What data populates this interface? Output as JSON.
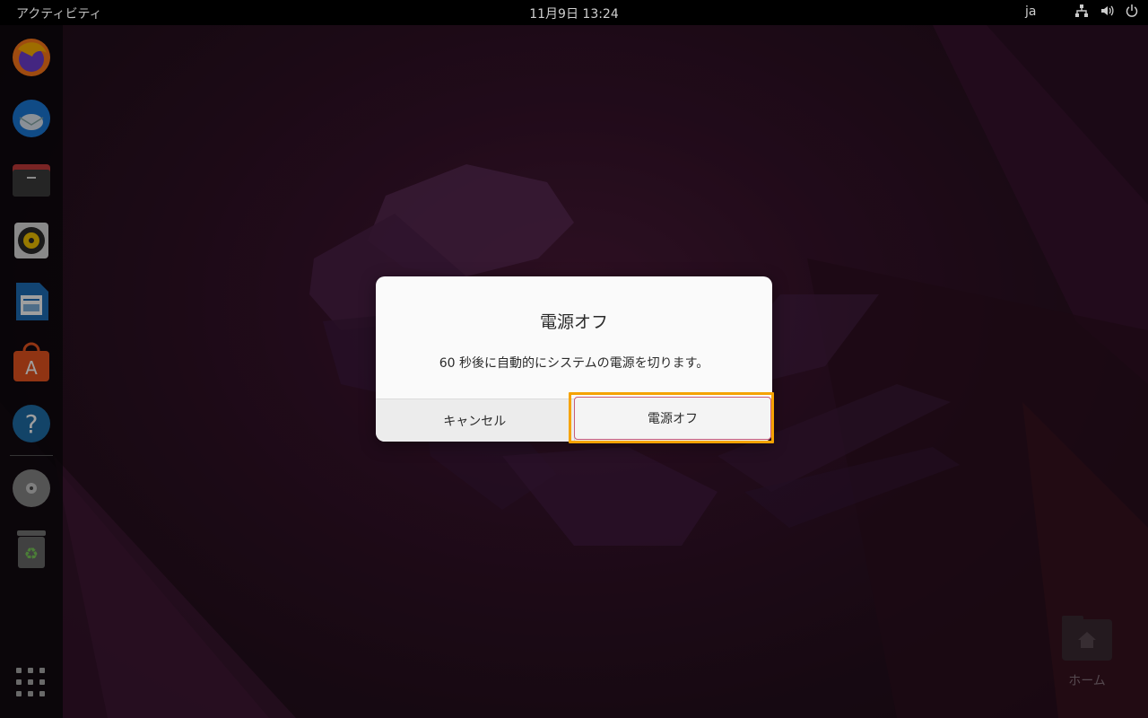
{
  "topbar": {
    "activities": "アクティビティ",
    "clock": "11月9日  13:24",
    "lang": "ja",
    "tray_icons": [
      "network-icon",
      "volume-icon",
      "power-icon"
    ]
  },
  "dock": {
    "apps": [
      {
        "name": "firefox-icon"
      },
      {
        "name": "thunderbird-icon"
      },
      {
        "name": "files-icon"
      },
      {
        "name": "rhythmbox-icon"
      },
      {
        "name": "writer-icon"
      },
      {
        "name": "software-icon"
      },
      {
        "name": "help-icon"
      },
      {
        "name": "dvd-icon"
      },
      {
        "name": "trash-icon"
      }
    ],
    "show_apps_icon": "grid-icon"
  },
  "desktop": {
    "home_label": "ホーム"
  },
  "dialog": {
    "title": "電源オフ",
    "message": "60 秒後に自動的にシステムの電源を切ります。",
    "cancel_label": "キャンセル",
    "confirm_label": "電源オフ"
  },
  "colors": {
    "highlight": "#f5a300",
    "dialog_bg": "#fafafa",
    "ubuntu_orange": "#e95420"
  }
}
